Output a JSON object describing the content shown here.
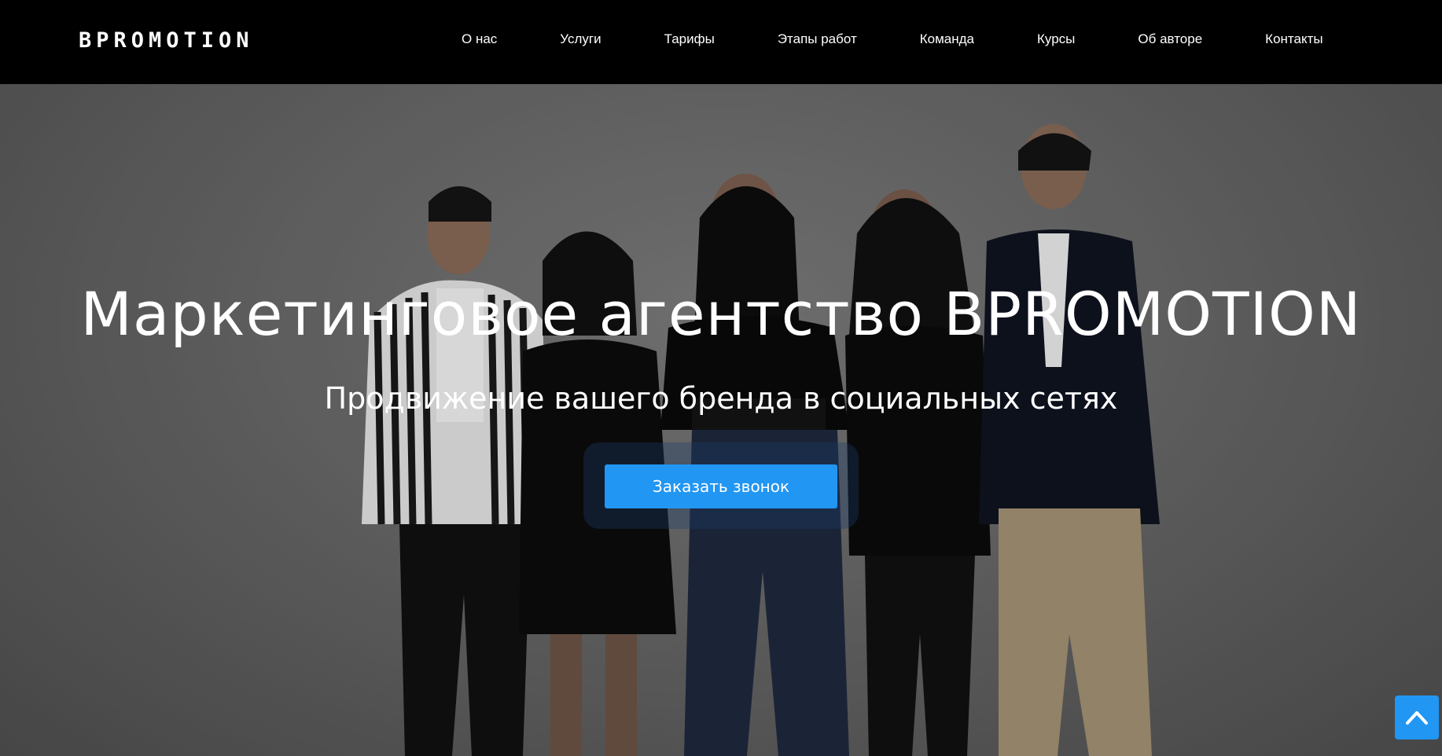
{
  "header": {
    "logo": "BPROMOTION",
    "nav": [
      {
        "label": "О нас"
      },
      {
        "label": "Услуги"
      },
      {
        "label": "Тарифы"
      },
      {
        "label": "Этапы работ"
      },
      {
        "label": "Команда"
      },
      {
        "label": "Курсы"
      },
      {
        "label": "Об авторе"
      },
      {
        "label": "Контакты"
      }
    ]
  },
  "hero": {
    "title": "Маркетинговое агентство BPROMOTION",
    "subtitle": "Продвижение вашего бренда в социальных сетях",
    "cta_label": "Заказать звонок"
  },
  "scroll_top": {
    "icon": "chevron-up-icon"
  },
  "colors": {
    "header_bg": "#000000",
    "accent": "#2196f3",
    "text": "#ffffff"
  }
}
